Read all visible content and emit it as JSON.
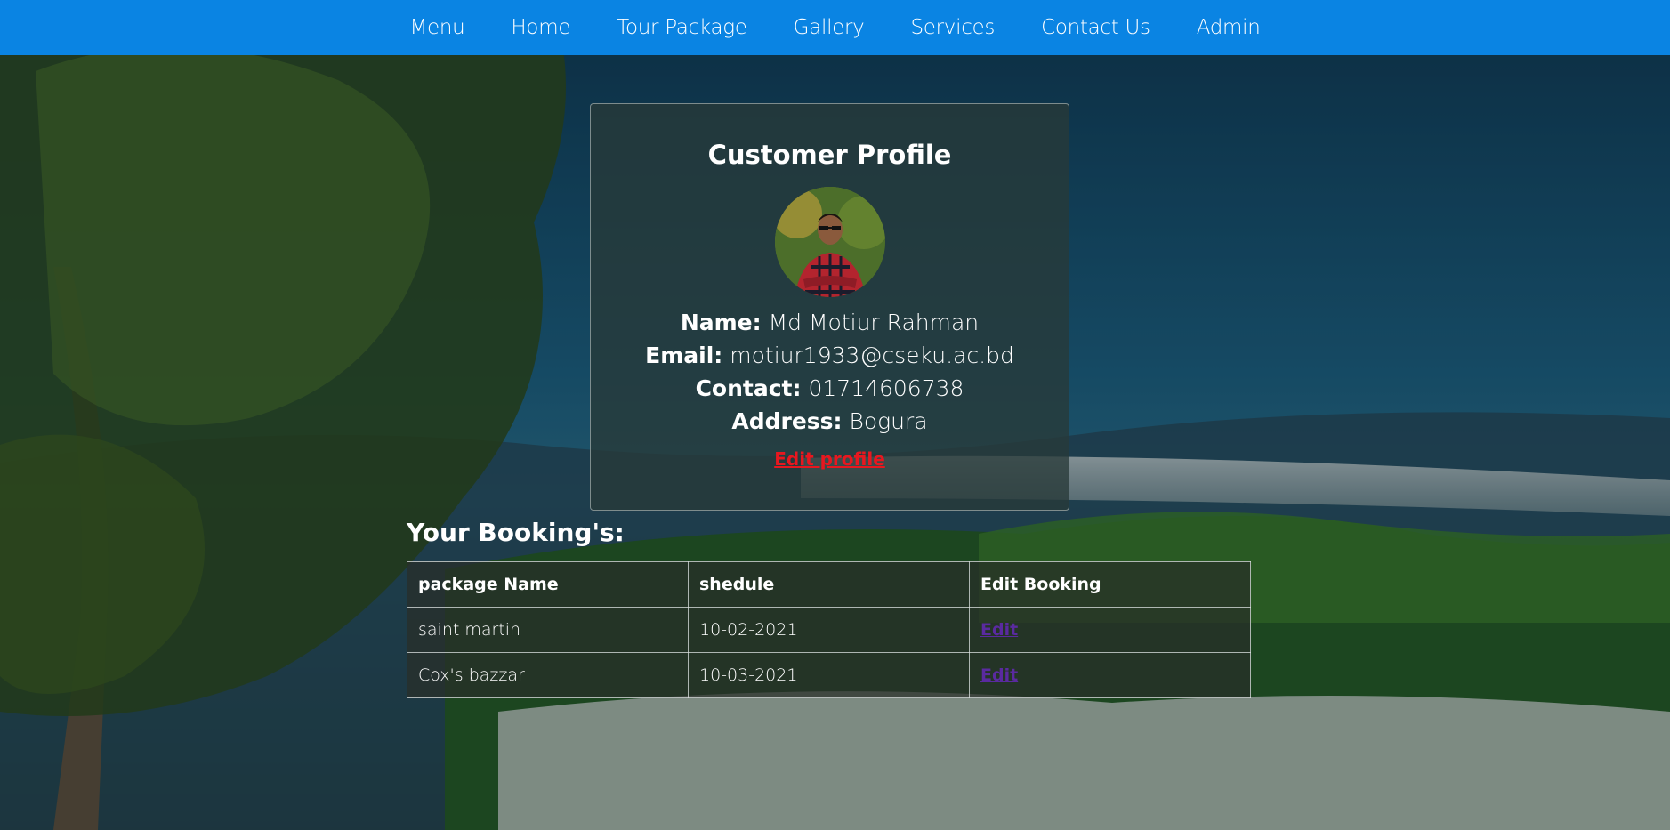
{
  "nav": {
    "items": [
      "Menu",
      "Home",
      "Tour Package",
      "Gallery",
      "Services",
      "Contact Us",
      "Admin"
    ]
  },
  "profile": {
    "title": "Customer Profile",
    "name_label": "Name:",
    "name": "Md Motiur Rahman",
    "email_label": "Email:",
    "email": "motiur1933@cseku.ac.bd",
    "contact_label": "Contact:",
    "contact": "01714606738",
    "address_label": "Address:",
    "address": "Bogura",
    "edit_label": "Edit profile"
  },
  "bookings": {
    "title": "Your Booking's:",
    "headers": [
      "package Name",
      "shedule",
      "Edit Booking"
    ],
    "rows": [
      {
        "package": "saint martin",
        "schedule": "10-02-2021",
        "edit": "Edit"
      },
      {
        "package": "Cox's bazzar",
        "schedule": "10-03-2021",
        "edit": "Edit"
      }
    ]
  },
  "colors": {
    "nav_bg": "#0a84e3",
    "edit_profile": "#e8171f",
    "edit_link": "#5a2aa0"
  }
}
